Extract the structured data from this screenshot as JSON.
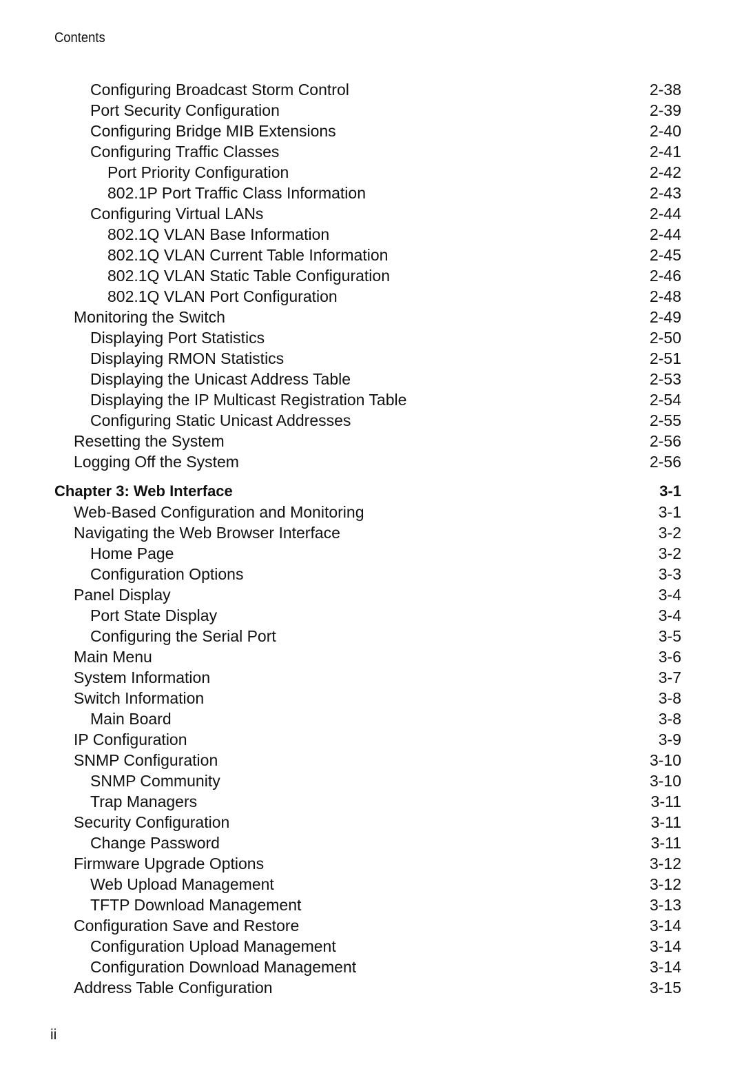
{
  "header": {
    "running_title": "Contents"
  },
  "footer": {
    "page_number": "ii"
  },
  "toc": [
    {
      "level": 2,
      "title": "Configuring Broadcast Storm Control",
      "page": "2-38"
    },
    {
      "level": 2,
      "title": "Port Security Configuration",
      "page": "2-39"
    },
    {
      "level": 2,
      "title": "Configuring Bridge MIB Extensions",
      "page": "2-40"
    },
    {
      "level": 2,
      "title": "Configuring Traffic Classes",
      "page": "2-41"
    },
    {
      "level": 3,
      "title": "Port Priority Configuration",
      "page": "2-42"
    },
    {
      "level": 3,
      "title": "802.1P Port Traffic Class Information",
      "page": "2-43"
    },
    {
      "level": 2,
      "title": "Configuring Virtual LANs",
      "page": "2-44"
    },
    {
      "level": 3,
      "title": "802.1Q VLAN Base Information",
      "page": "2-44"
    },
    {
      "level": 3,
      "title": "802.1Q VLAN Current Table Information",
      "page": "2-45"
    },
    {
      "level": 3,
      "title": "802.1Q VLAN Static Table Configuration",
      "page": "2-46"
    },
    {
      "level": 3,
      "title": "802.1Q VLAN Port Configuration",
      "page": "2-48"
    },
    {
      "level": 1,
      "title": "Monitoring the Switch",
      "page": "2-49"
    },
    {
      "level": 2,
      "title": "Displaying Port Statistics",
      "page": "2-50"
    },
    {
      "level": 2,
      "title": "Displaying RMON Statistics",
      "page": "2-51"
    },
    {
      "level": 2,
      "title": "Displaying the Unicast Address Table",
      "page": "2-53"
    },
    {
      "level": 2,
      "title": "Displaying the IP Multicast Registration Table",
      "page": "2-54"
    },
    {
      "level": 2,
      "title": "Configuring Static Unicast Addresses",
      "page": "2-55"
    },
    {
      "level": 1,
      "title": "Resetting the System",
      "page": "2-56"
    },
    {
      "level": 1,
      "title": "Logging Off the System",
      "page": "2-56"
    },
    {
      "level": 0,
      "title": "Chapter 3: Web Interface",
      "page": "3-1",
      "chapter": true
    },
    {
      "level": 1,
      "title": "Web-Based Configuration and Monitoring",
      "page": "3-1"
    },
    {
      "level": 1,
      "title": "Navigating the Web Browser Interface",
      "page": "3-2"
    },
    {
      "level": 2,
      "title": "Home Page",
      "page": "3-2"
    },
    {
      "level": 2,
      "title": "Configuration Options",
      "page": "3-3"
    },
    {
      "level": 1,
      "title": "Panel Display",
      "page": "3-4"
    },
    {
      "level": 2,
      "title": "Port State Display",
      "page": "3-4"
    },
    {
      "level": 2,
      "title": "Configuring the Serial Port",
      "page": "3-5"
    },
    {
      "level": 1,
      "title": "Main Menu",
      "page": "3-6"
    },
    {
      "level": 1,
      "title": "System Information",
      "page": "3-7"
    },
    {
      "level": 1,
      "title": "Switch Information",
      "page": "3-8"
    },
    {
      "level": 2,
      "title": "Main Board",
      "page": "3-8"
    },
    {
      "level": 1,
      "title": "IP Configuration",
      "page": "3-9"
    },
    {
      "level": 1,
      "title": "SNMP Configuration",
      "page": "3-10"
    },
    {
      "level": 2,
      "title": "SNMP Community",
      "page": "3-10"
    },
    {
      "level": 2,
      "title": "Trap Managers",
      "page": "3-11"
    },
    {
      "level": 1,
      "title": "Security Configuration",
      "page": "3-11"
    },
    {
      "level": 2,
      "title": "Change Password",
      "page": "3-11"
    },
    {
      "level": 1,
      "title": "Firmware Upgrade Options",
      "page": "3-12"
    },
    {
      "level": 2,
      "title": "Web Upload Management",
      "page": "3-12"
    },
    {
      "level": 2,
      "title": "TFTP Download Management",
      "page": "3-13"
    },
    {
      "level": 1,
      "title": "Configuration Save and Restore",
      "page": "3-14"
    },
    {
      "level": 2,
      "title": "Configuration Upload Management",
      "page": "3-14"
    },
    {
      "level": 2,
      "title": "Configuration Download Management",
      "page": "3-14"
    },
    {
      "level": 1,
      "title": "Address Table Configuration",
      "page": "3-15"
    }
  ]
}
